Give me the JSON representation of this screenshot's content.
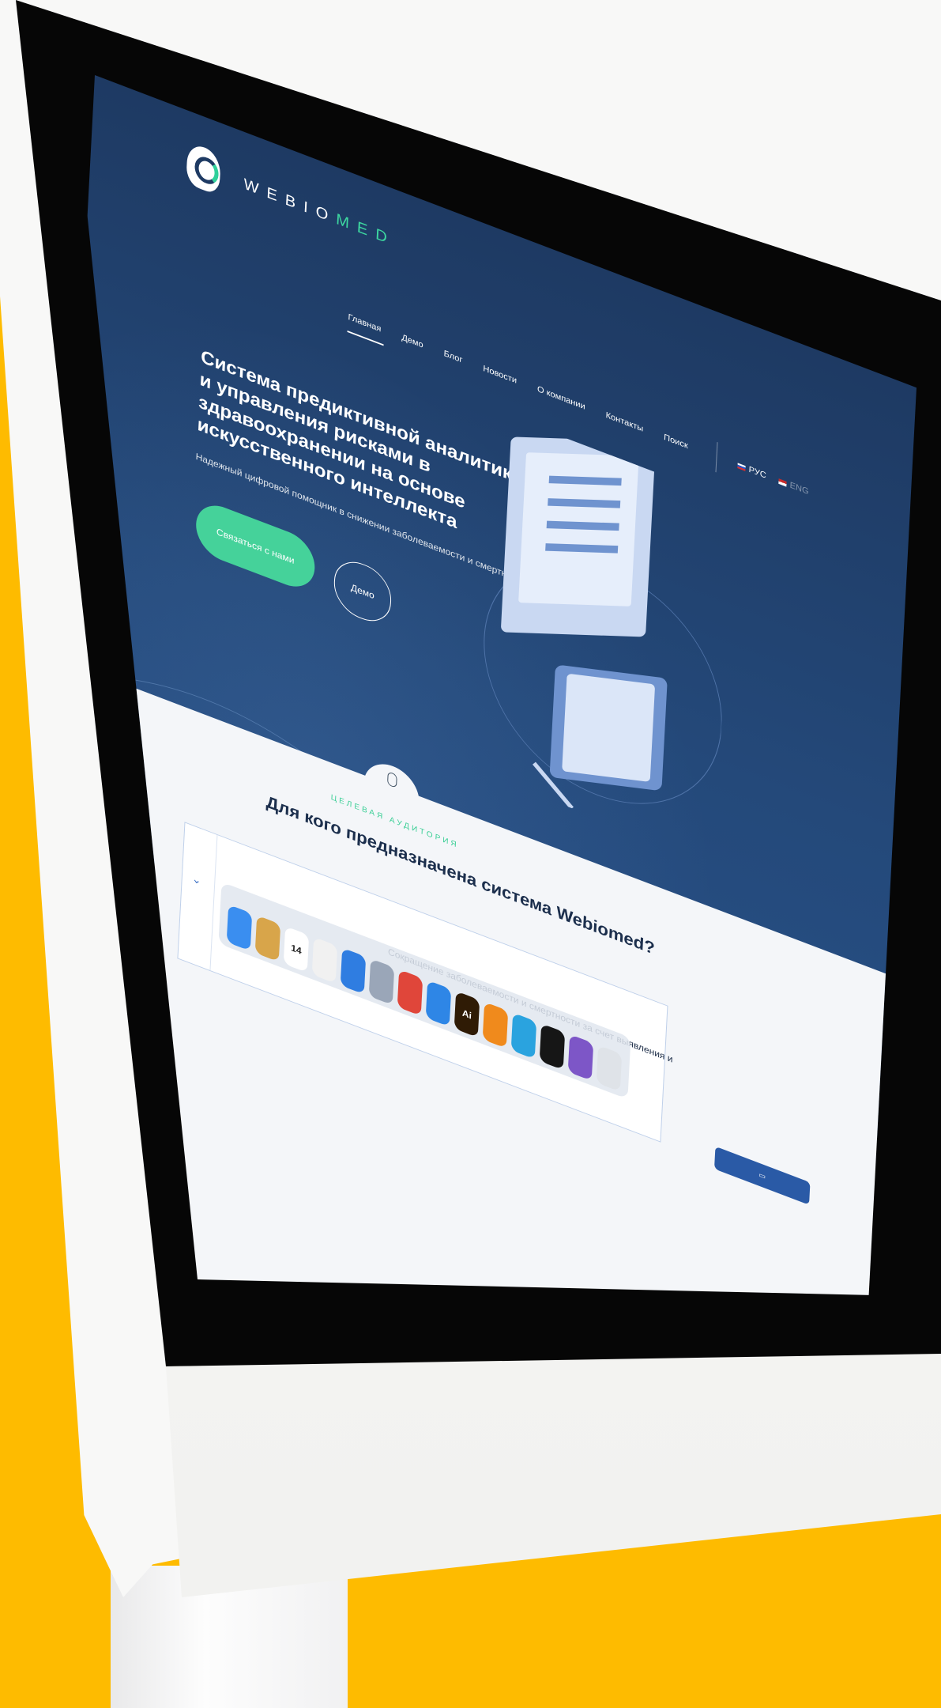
{
  "logo": {
    "text_main": "WEBIO",
    "text_accent": "MED"
  },
  "nav": {
    "items": [
      {
        "label": "Главная",
        "active": true
      },
      {
        "label": "Демо",
        "active": false
      },
      {
        "label": "Блог",
        "active": false
      },
      {
        "label": "Новости",
        "active": false
      },
      {
        "label": "О компании",
        "active": false
      },
      {
        "label": "Контакты",
        "active": false
      },
      {
        "label": "Поиск",
        "active": false
      }
    ],
    "languages": [
      {
        "label": "РУС",
        "active": true
      },
      {
        "label": "ENG",
        "active": false
      }
    ]
  },
  "hero": {
    "title": "Система предиктивной аналитики и управления рисками в здравоохранении на основе искусственного интеллекта",
    "subtitle": "Надежный цифровой помощник в снижении заболеваемости и смертности",
    "primary_button": "Связаться с нами",
    "secondary_button": "Демо"
  },
  "audience": {
    "eyebrow": "ЦЕЛЕВАЯ АУДИТОРИЯ",
    "title": "Для кого предназначена система Webiomed?",
    "card_text": "Сокращение заболеваемости и смертности за счет выявления и"
  },
  "dock": {
    "apps": [
      {
        "icon": "finder-icon",
        "color": "#3a8ef0",
        "label": ""
      },
      {
        "icon": "notes-icon",
        "color": "#d8a54a",
        "label": ""
      },
      {
        "icon": "calendar-icon",
        "color": "#ffffff",
        "label": "14"
      },
      {
        "icon": "screenshot-icon",
        "color": "#f1f1f1",
        "label": ""
      },
      {
        "icon": "maps-icon",
        "color": "#2f7de1",
        "label": ""
      },
      {
        "icon": "launchpad-icon",
        "color": "#9aa6b8",
        "label": ""
      },
      {
        "icon": "chrome-icon",
        "color": "#e0463a",
        "label": ""
      },
      {
        "icon": "safari-icon",
        "color": "#2e86e6",
        "label": ""
      },
      {
        "icon": "illustrator-icon",
        "color": "#2f1b05",
        "label": "Ai"
      },
      {
        "icon": "books-icon",
        "color": "#f08a1c",
        "label": ""
      },
      {
        "icon": "telegram-icon",
        "color": "#2aa3df",
        "label": ""
      },
      {
        "icon": "acrobat-icon",
        "color": "#161616",
        "label": ""
      },
      {
        "icon": "viber-icon",
        "color": "#7d56c7",
        "label": ""
      },
      {
        "icon": "trash-icon",
        "color": "#dfe3e8",
        "label": ""
      }
    ]
  },
  "colors": {
    "background": "#FEBB00",
    "hero_dark": "#1e3a63",
    "accent_green": "#45d29a"
  }
}
